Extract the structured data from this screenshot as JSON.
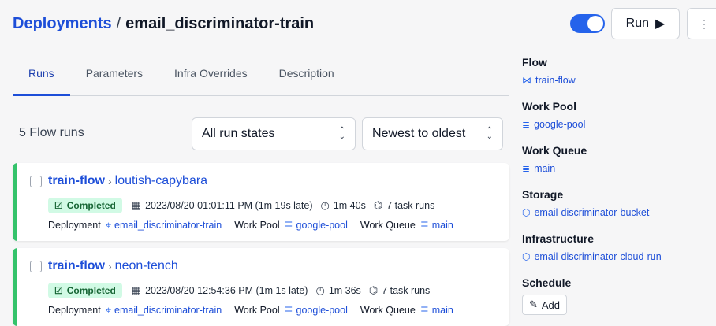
{
  "header": {
    "breadcrumb_link": "Deployments",
    "separator": "/",
    "current": "email_discriminator-train"
  },
  "controls": {
    "toggle_on": true,
    "run_label": "Run",
    "run_icon": "play-icon",
    "more_icon": "vertical-ellipsis-icon"
  },
  "tabs": [
    {
      "label": "Runs",
      "active": true
    },
    {
      "label": "Parameters",
      "active": false
    },
    {
      "label": "Infra Overrides",
      "active": false
    },
    {
      "label": "Description",
      "active": false
    }
  ],
  "runs": {
    "count_label": "5 Flow runs",
    "state_filter": "All run states",
    "sort": "Newest to oldest",
    "items": [
      {
        "flow": "train-flow",
        "name": "loutish-capybara",
        "status": "Completed",
        "timestamp": "2023/08/20 01:01:11 PM (1m 19s late)",
        "duration": "1m 40s",
        "task_runs": "7 task runs",
        "deployment_label": "Deployment",
        "deployment": "email_discriminator-train",
        "work_pool_label": "Work Pool",
        "work_pool": "google-pool",
        "work_queue_label": "Work Queue",
        "work_queue": "main"
      },
      {
        "flow": "train-flow",
        "name": "neon-tench",
        "status": "Completed",
        "timestamp": "2023/08/20 12:54:36 PM (1m 1s late)",
        "duration": "1m 36s",
        "task_runs": "7 task runs",
        "deployment_label": "Deployment",
        "deployment": "email_discriminator-train",
        "work_pool_label": "Work Pool",
        "work_pool": "google-pool",
        "work_queue_label": "Work Queue",
        "work_queue": "main"
      }
    ]
  },
  "sidebar": {
    "flow_label": "Flow",
    "flow": "train-flow",
    "work_pool_label": "Work Pool",
    "work_pool": "google-pool",
    "work_queue_label": "Work Queue",
    "work_queue": "main",
    "storage_label": "Storage",
    "storage": "email-discriminator-bucket",
    "infrastructure_label": "Infrastructure",
    "infrastructure": "email-discriminator-cloud-run",
    "schedule_label": "Schedule",
    "add_label": "Add"
  },
  "colors": {
    "accent": "#1d4ed8",
    "toggle": "#2563eb",
    "completed_border": "#34c36b",
    "completed_badge_bg": "#d1fae5"
  }
}
